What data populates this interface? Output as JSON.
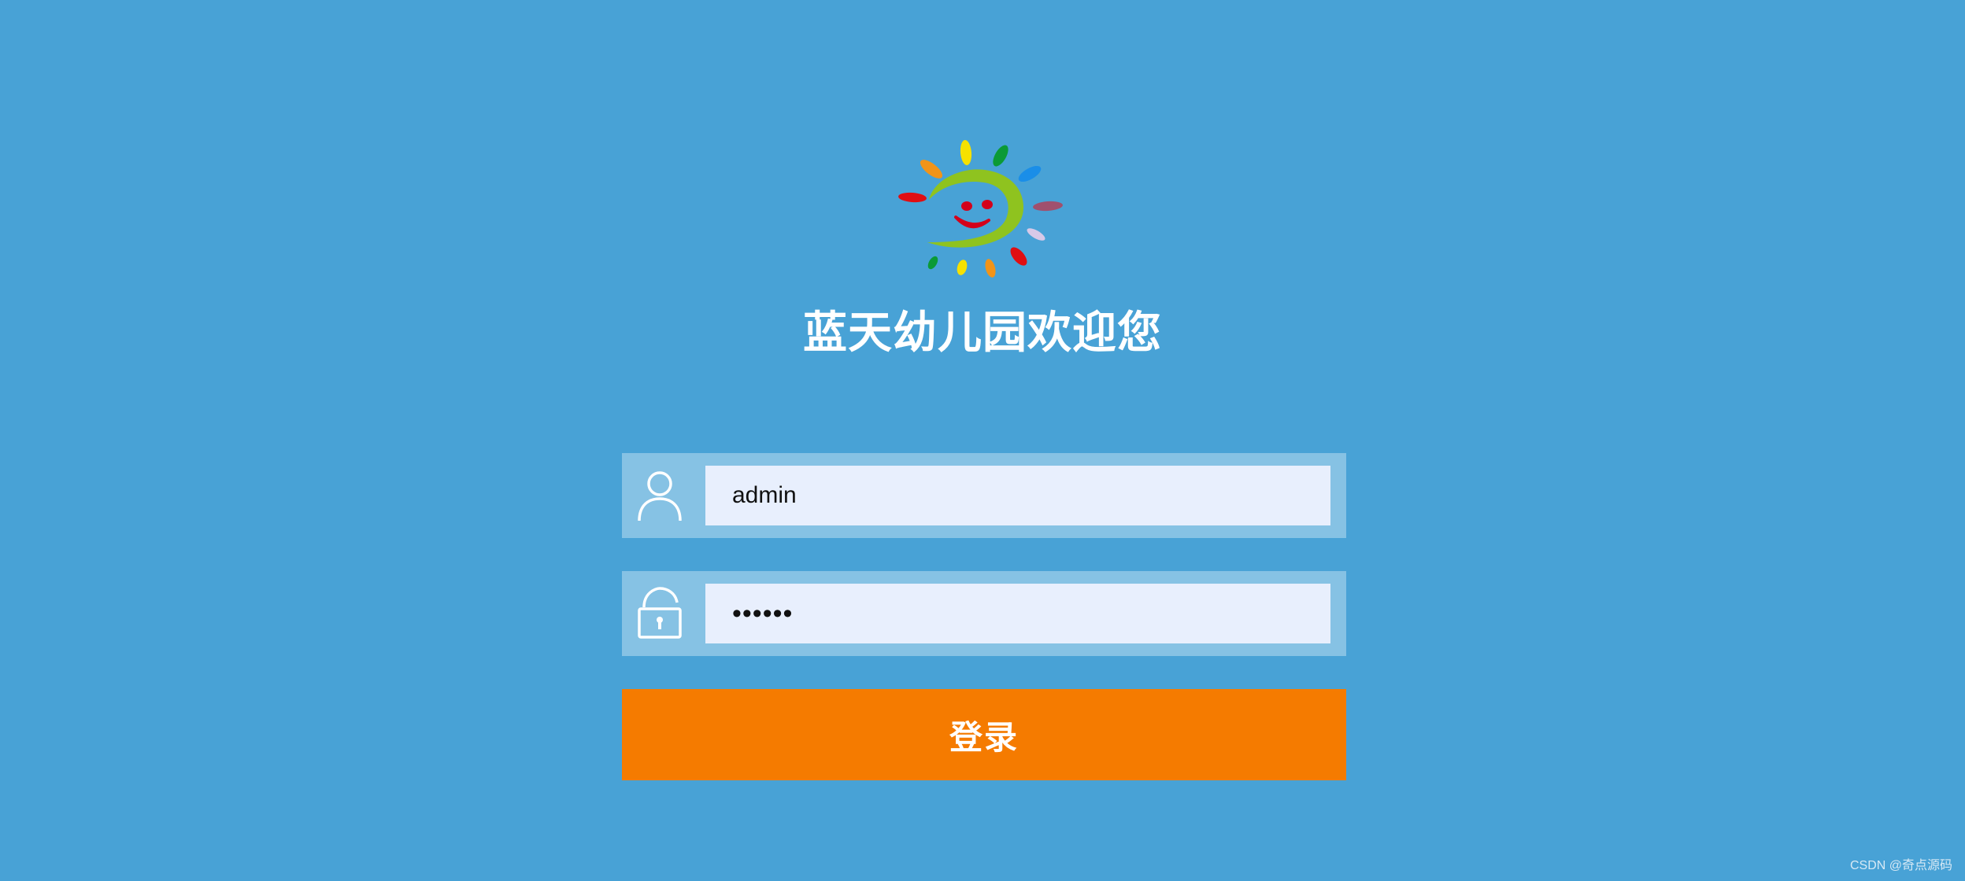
{
  "page": {
    "title": "蓝天幼儿园欢迎您",
    "background_color": "#48a2d6",
    "accent_color": "#f57b00"
  },
  "logo": {
    "icon": "sun-smiley-logo-icon"
  },
  "form": {
    "username": {
      "icon": "user-icon",
      "value": "admin"
    },
    "password": {
      "icon": "unlock-icon",
      "value": "••••••"
    },
    "login_label": "登录"
  },
  "watermark": "CSDN @奇点源码"
}
